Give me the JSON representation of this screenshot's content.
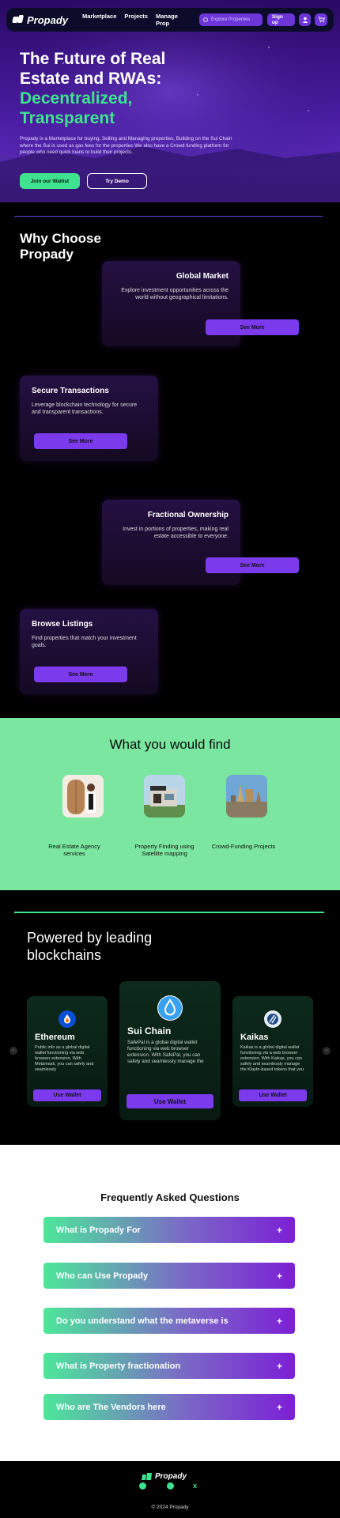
{
  "nav": {
    "logo": "Propady",
    "links": [
      "Marketplace",
      "Projects",
      "Manage Prop"
    ],
    "search_placeholder": "Explore Properties",
    "signup": "Sign up"
  },
  "hero": {
    "title_line1": "The Future of Real",
    "title_line2": "Estate and RWAs:",
    "title_green1": "Decentralized,",
    "title_green2": "Transparent",
    "description": "Propady is a Marketplace for buying, Selling and Managing properties, Building on the Sui Chain where the Sui is used as gas fees for the properties We also have a Crowd funding platform for people who need quick loans to build their projects.",
    "join_button": "Join our Wallist",
    "demo_button": "Try Demo"
  },
  "why": {
    "title": "Why Choose Propady",
    "features": [
      {
        "title": "Global Market",
        "description": "Explore investment opportunities across the world without geographical limitations.",
        "button": "See More"
      },
      {
        "title": "Secure Transactions",
        "description": "Leverage blockchain technology for secure and transparent transactions.",
        "button": "See More"
      },
      {
        "title": "Fractional Ownership",
        "description": "Invest in portions of properties, making real estate accessible to everyone.",
        "button": "See More"
      },
      {
        "title": "Browse Listings",
        "description": "Find properties that match your investment goals.",
        "button": "See More"
      }
    ]
  },
  "find": {
    "title": "What you would find",
    "items": [
      {
        "label": "Real Estate Agency services"
      },
      {
        "label": "Property Finding using Satellite mapping"
      },
      {
        "label": "Crowd-Funding Projects"
      }
    ]
  },
  "blockchains": {
    "title": "Powered by leading blockchains",
    "cards": [
      {
        "name": "Ethereum",
        "description": "Public info as a global digital wallet functioning via web browser extension. With Metamask, you can safely and seamlessly",
        "button": "Use Wallet"
      },
      {
        "name": "Sui Chain",
        "description": "SafePal is a global digital wallet functioning via web browser extension. With SafePal, you can safely and seamlessly manage the",
        "button": "Use Wallet"
      },
      {
        "name": "Kaikas",
        "description": "Kaikas is a global digital wallet functioning via a web browser extension. With Kaikas, you can safely and seamlessly manage the Klaytn-based tokens that you",
        "button": "Use Wallet"
      }
    ]
  },
  "faq": {
    "title": "Frequently Asked Questions",
    "items": [
      "What is Propady For",
      "Who can Use Propady",
      "Do you understand what the metaverse is",
      "What is Property fractionation",
      "Who are The Vendors here"
    ]
  },
  "footer": {
    "logo": "Propady",
    "copyright": "© 2024 Propady"
  }
}
